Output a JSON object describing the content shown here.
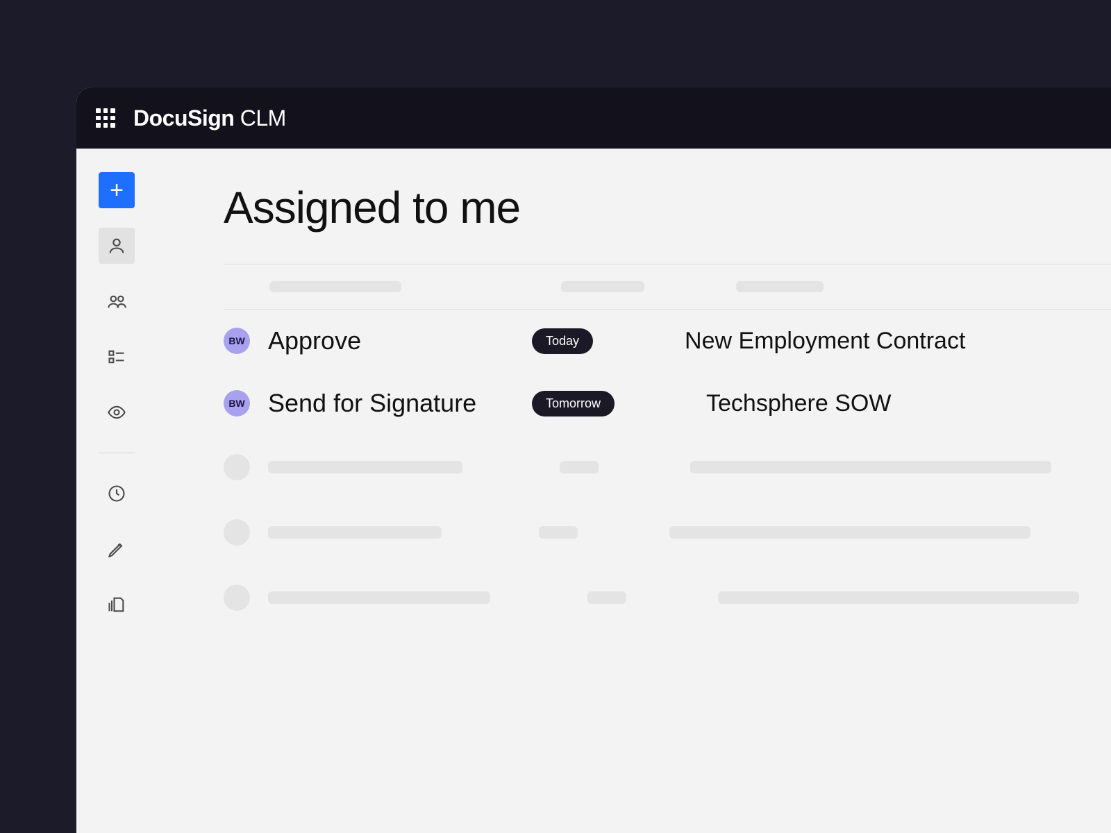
{
  "header": {
    "brand_bold": "DocuSign",
    "brand_light": " CLM"
  },
  "page": {
    "title": "Assigned to me"
  },
  "tasks": [
    {
      "avatar_initials": "BW",
      "action": "Approve",
      "due": "Today",
      "document": "New Employment Contract"
    },
    {
      "avatar_initials": "BW",
      "action": "Send for Signature",
      "due": "Tomorrow",
      "document": "Techsphere SOW"
    }
  ]
}
